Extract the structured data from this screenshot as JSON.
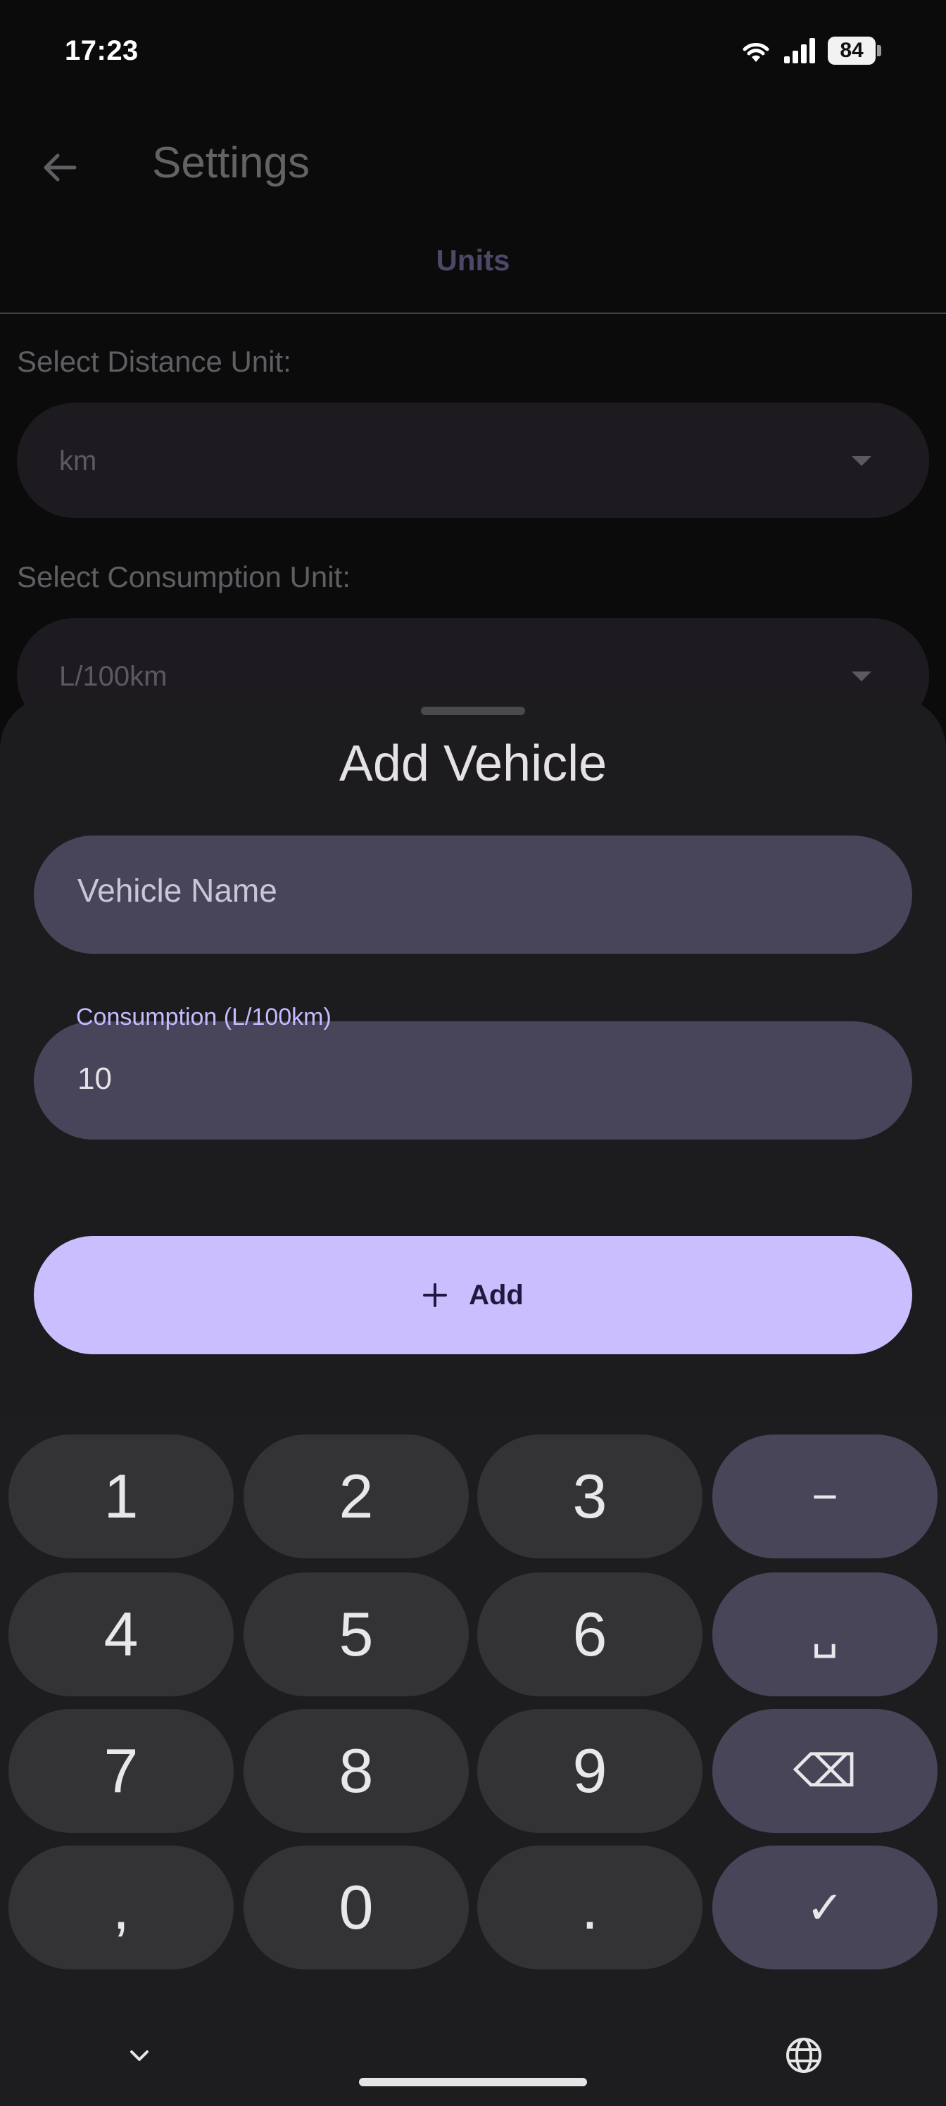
{
  "status_bar": {
    "time": "17:23",
    "battery": "84"
  },
  "header": {
    "title": "Settings",
    "tab": "Units"
  },
  "settings": {
    "distance_label": "Select Distance Unit:",
    "distance_value": "km",
    "consumption_label": "Select Consumption Unit:",
    "consumption_value": "L/100km"
  },
  "sheet": {
    "title": "Add Vehicle",
    "name_placeholder": "Vehicle Name",
    "consumption_label": "Consumption (L/100km)",
    "consumption_value": "10",
    "add_label": "Add"
  },
  "keyboard": {
    "keys": [
      "1",
      "2",
      "3",
      "−",
      "4",
      "5",
      "6",
      "␣",
      "7",
      "8",
      "9",
      "⌫",
      ",",
      "0",
      ".",
      "✓"
    ]
  },
  "colors": {
    "accent": "#cbbefe",
    "field_bg": "#48455a",
    "sheet_bg": "#1c1b1d"
  }
}
